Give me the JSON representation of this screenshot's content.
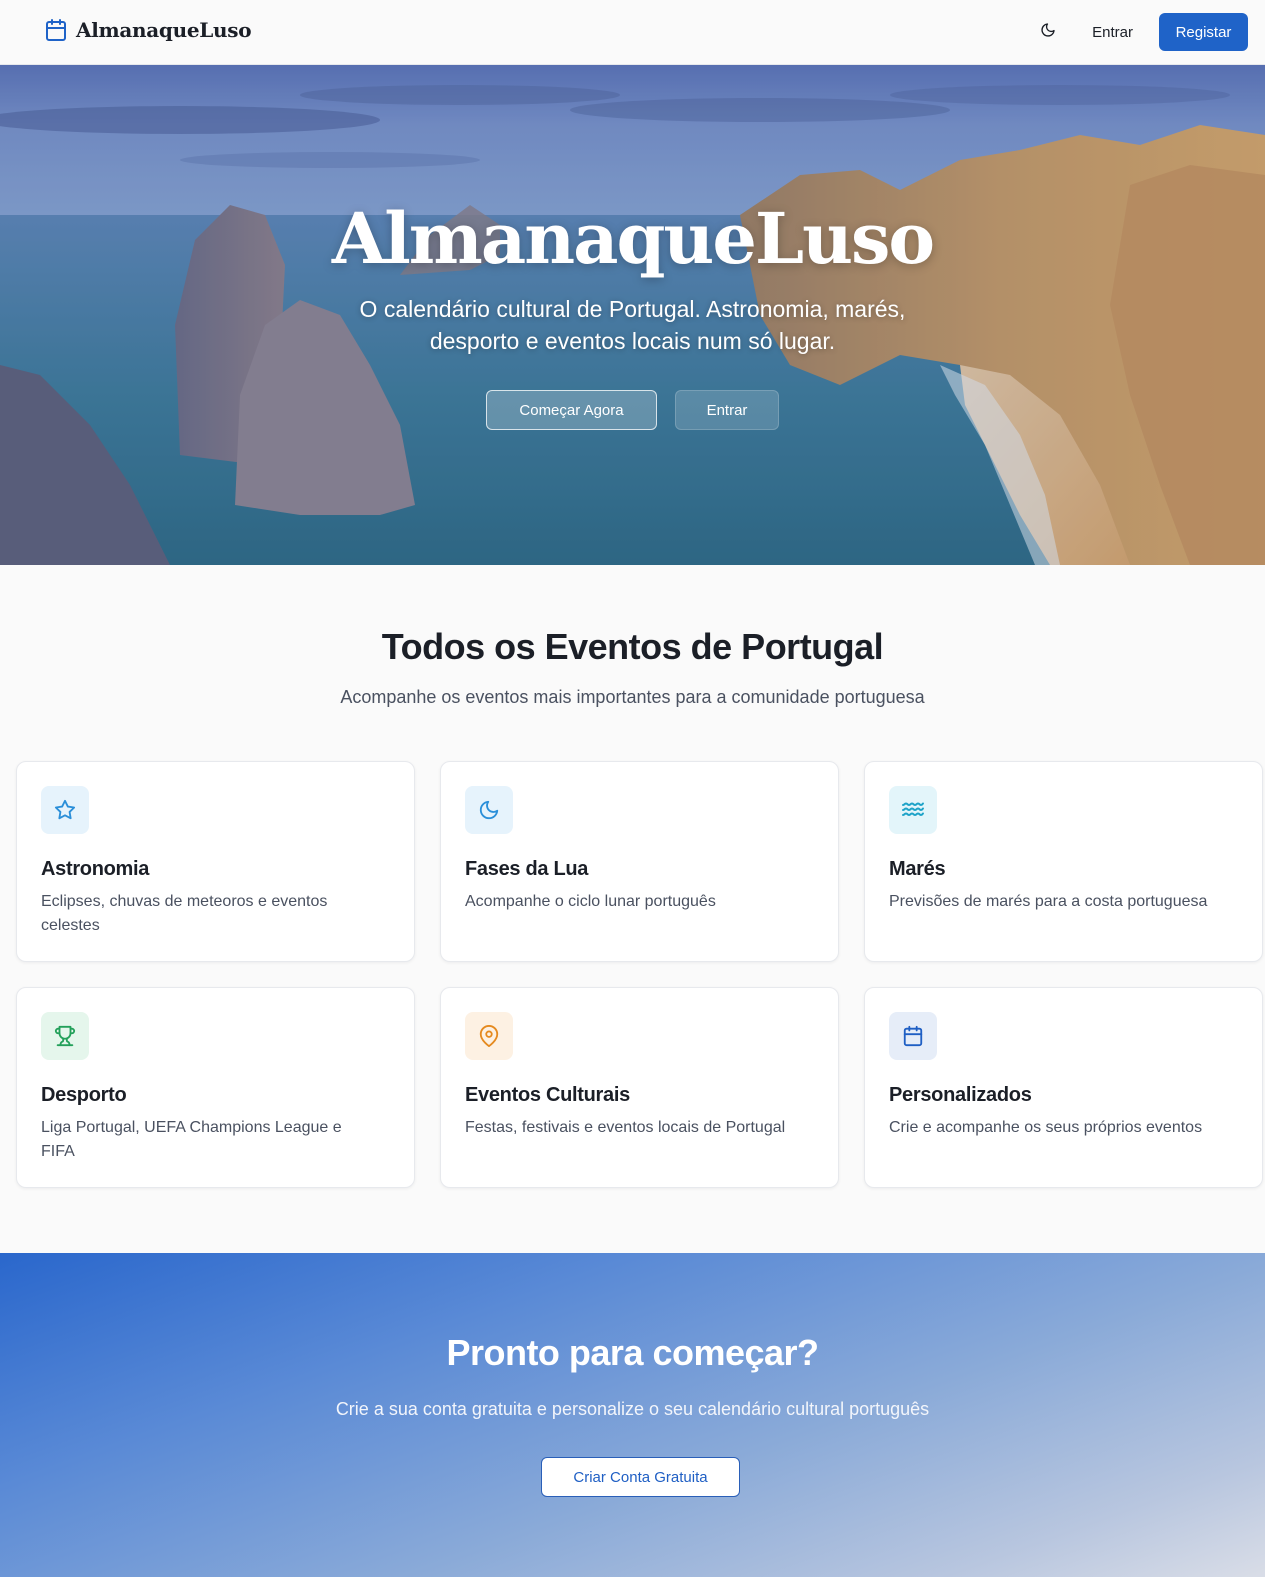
{
  "navbar": {
    "brand_name": "AlmanaqueLuso",
    "brand_icon": "calendar-icon",
    "theme_toggle_icon": "moon-icon",
    "login_label": "Entrar",
    "register_label": "Registar"
  },
  "hero": {
    "title": "AlmanaqueLuso",
    "subtitle": "O calendário cultural de Portugal. Astronomia, marés, desporto e eventos locais num só lugar.",
    "start_label": "Começar Agora",
    "login_label": "Entrar"
  },
  "features": {
    "title": "Todos os Eventos de Portugal",
    "subtitle": "Acompanhe os eventos mais importantes para a comunidade portuguesa",
    "cards": [
      {
        "title": "Astronomia",
        "description": "Eclipses, chuvas de meteoros e eventos celestes",
        "icon": "star-icon",
        "color": "#2b8fd9",
        "bg": "#e6f3fc"
      },
      {
        "title": "Fases da Lua",
        "description": "Acompanhe o ciclo lunar português",
        "icon": "moon-icon",
        "color": "#2b8fd9",
        "bg": "#e6f3fc"
      },
      {
        "title": "Marés",
        "description": "Previsões de marés para a costa portuguesa",
        "icon": "waves-icon",
        "color": "#1ea3c8",
        "bg": "#e3f5fa"
      },
      {
        "title": "Desporto",
        "description": "Liga Portugal, UEFA Champions League e FIFA",
        "icon": "trophy-icon",
        "color": "#23a05a",
        "bg": "#e5f6ec"
      },
      {
        "title": "Eventos Culturais",
        "description": "Festas, festivais e eventos locais de Portugal",
        "icon": "map-pin-icon",
        "color": "#e58a1f",
        "bg": "#fdf1e3"
      },
      {
        "title": "Personalizados",
        "description": "Crie e acompanhe os seus próprios eventos",
        "icon": "calendar-icon",
        "color": "#1f5fc4",
        "bg": "#e6edf8"
      }
    ]
  },
  "cta": {
    "title": "Pronto para começar?",
    "subtitle": "Crie a sua conta gratuita e personalize o seu calendário cultural português",
    "button_label": "Criar Conta Gratuita"
  },
  "colors": {
    "primary": "#1f63c8",
    "text": "#1b1f27",
    "muted": "#4a5160",
    "background": "#fafafa"
  }
}
